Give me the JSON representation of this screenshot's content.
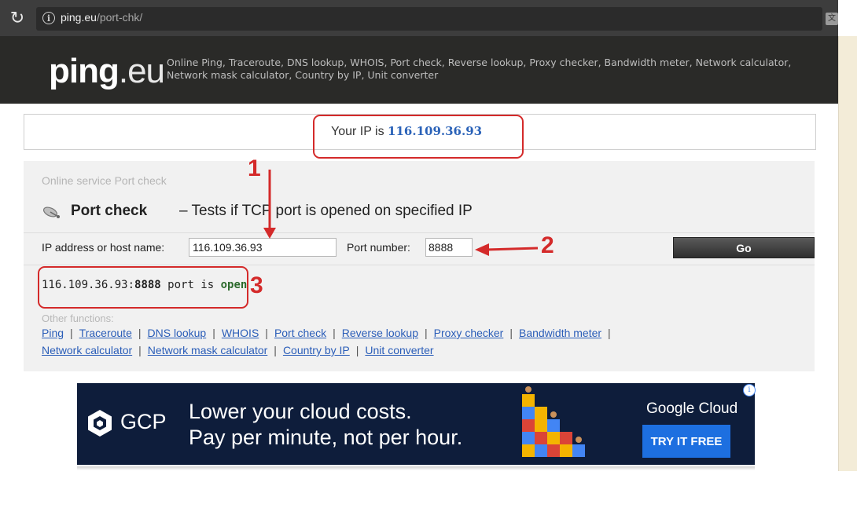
{
  "browser": {
    "url_host": "ping.eu",
    "url_path": "/port-chk/"
  },
  "site": {
    "logo_bold": "ping",
    "logo_light": ".eu",
    "tagline": "Online Ping, Traceroute, DNS lookup, WHOIS, Port check, Reverse lookup, Proxy checker, Bandwidth meter, Network calculator, Network mask calculator, Country by IP, Unit converter"
  },
  "ip_banner": {
    "label": "Your IP is ",
    "ip": "116.109.36.93"
  },
  "service": {
    "label": "Online service Port check",
    "title": "Port check",
    "subtitle": "– Tests if TCP port is opened on specified IP"
  },
  "form": {
    "ip_label": "IP address or host name:",
    "ip_value": "116.109.36.93",
    "port_label": "Port number:",
    "port_value": "8888",
    "go_label": "Go"
  },
  "result": {
    "host_port": "116.109.36.93:",
    "port": "8888",
    "middle": " port is ",
    "status": "open"
  },
  "other_functions": {
    "label": "Other functions:",
    "row1": [
      "Ping",
      "Traceroute",
      "DNS lookup",
      "WHOIS",
      "Port check",
      "Reverse lookup",
      "Proxy checker",
      "Bandwidth meter"
    ],
    "row2": [
      "Network calculator",
      "Network mask calculator",
      "Country by IP",
      "Unit converter"
    ]
  },
  "annotations": {
    "n1": "1",
    "n2": "2",
    "n3": "3",
    "color": "#d42a2a"
  },
  "ad": {
    "brand": "GCP",
    "line1": "Lower your cloud costs.",
    "line2": "Pay per minute, not per hour.",
    "google_cloud": "Google Cloud",
    "cta": "TRY IT FREE"
  },
  "colors": {
    "link": "#2a5db8",
    "ip_highlight": "#2a62b8",
    "ad_bg": "#0e1d3b",
    "cta_bg": "#1d6fe0"
  }
}
